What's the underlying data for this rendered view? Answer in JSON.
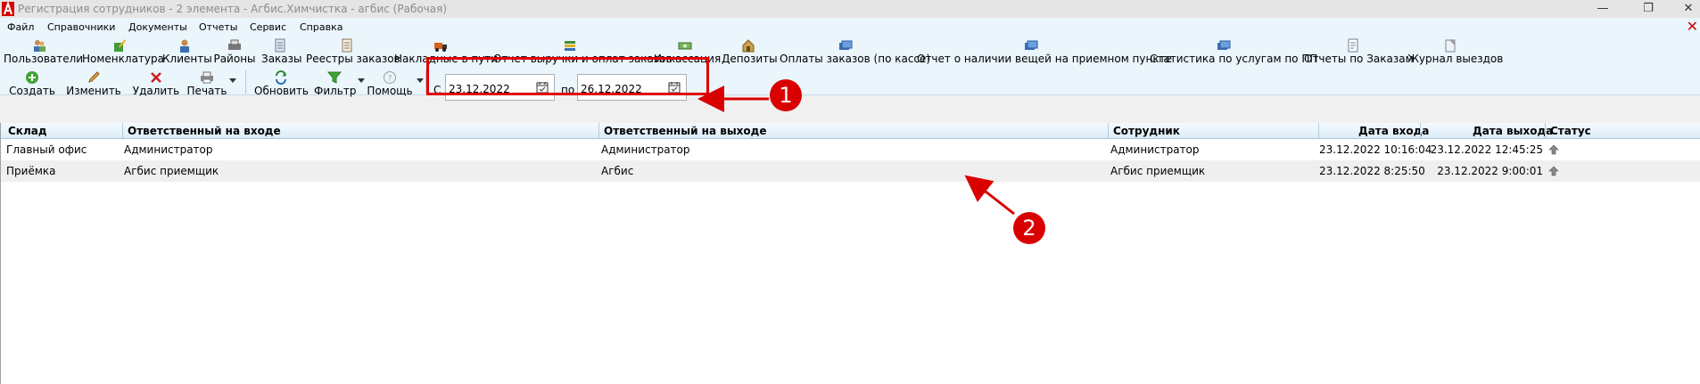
{
  "window": {
    "title": "Регистрация сотрудников - 2 элемента - Агбис.Химчистка - агбис (Рабочая)",
    "min_glyph": "—",
    "restore_glyph": "❐",
    "close_glyph": "✕"
  },
  "menu": {
    "items": [
      "Файл",
      "Справочники",
      "Документы",
      "Отчеты",
      "Сервис",
      "Справка"
    ],
    "close_glyph": "✕"
  },
  "toolbar": {
    "items": [
      "Пользователи",
      "Номенклатура",
      "Клиенты",
      "Районы",
      "Заказы",
      "Реестры заказов",
      "Накладные в пути",
      "Отчет выручки и оплат заказов",
      "Инкассация",
      "Депозиты",
      "Оплаты заказов (по кассе)",
      "Отчет о наличии вещей на приемном пункте",
      "Статистика по услугам по ПП",
      "Отчеты по Заказам",
      "Журнал выездов"
    ]
  },
  "actions": {
    "create": "Создать",
    "edit": "Изменить",
    "delete": "Удалить",
    "print": "Печать",
    "refresh": "Обновить",
    "filter": "Фильтр",
    "help": "Помощь"
  },
  "date_filter": {
    "from_label": "С",
    "from_value": "23.12.2022",
    "to_label": "по",
    "to_value": "26.12.2022"
  },
  "grid": {
    "columns": [
      "Склад",
      "Ответственный на входе",
      "Ответственный на выходе",
      "Сотрудник",
      "Дата входа",
      "Дата выхода",
      "Статус"
    ],
    "rows": [
      [
        "Главный офис",
        "Администратор",
        "Администратор",
        "Администратор",
        "23.12.2022 10:16:04",
        "23.12.2022 12:45:25"
      ],
      [
        "Приёмка",
        "Агбис приемщик",
        "Агбис",
        "Агбис приемщик",
        "23.12.2022 8:25:50",
        "23.12.2022 9:00:01"
      ]
    ]
  },
  "callouts": [
    "1",
    "2"
  ],
  "colors": {
    "accent_red": "#d90000",
    "toolbar_bg": "#eaf5fc",
    "row_alt": "#efefef"
  }
}
